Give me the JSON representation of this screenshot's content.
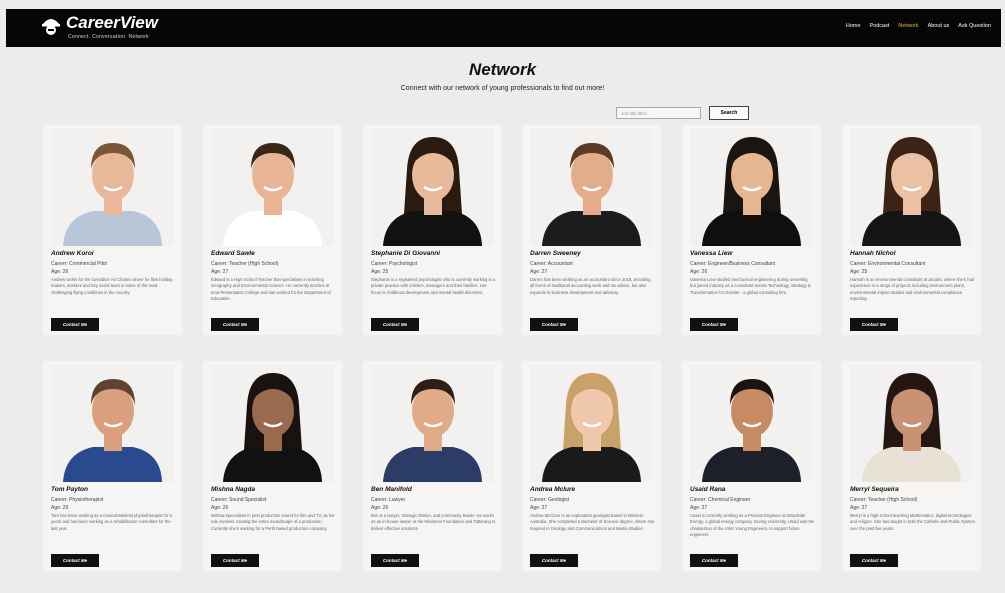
{
  "brand": {
    "name": "CareerView",
    "tagline": "Connect. Conversation. Network"
  },
  "nav": [
    {
      "label": "Home",
      "active": false
    },
    {
      "label": "Podcast",
      "active": false
    },
    {
      "label": "Network",
      "active": true
    },
    {
      "label": "About us",
      "active": false
    },
    {
      "label": "Ask Question",
      "active": false
    }
  ],
  "page": {
    "title": "Network",
    "subtitle": "Connect with our network of young professionals to find out more!"
  },
  "search": {
    "placeholder": "Job title filter...",
    "button_label": "Search"
  },
  "contact_label": "Contact Me",
  "colors": {
    "accent": "#e3b23c",
    "header_bg": "#060606",
    "page_bg": "#eeeceb"
  },
  "profiles": [
    {
      "name": "Andrew Koroi",
      "career": "Career: Commercial Pilot",
      "age": "Age: 26",
      "bio": "Andrew works for the Geraldton Air Charter where he flies holiday makers, workers and tory aerial tours in some of the most challenging flying conditions in the country."
    },
    {
      "name": "Edward Sawle",
      "career": "Career: Teacher (High School)",
      "age": "Age: 27",
      "bio": "Edward is a High School Teacher that specialises in teaching Geography and Environmental Science. He currently teaches at Iona Presentation College and has worked for the Department of Education."
    },
    {
      "name": "Stephanie Di Giovanni",
      "career": "Career: Psychologist",
      "age": "Age: 25",
      "bio": "Stephanie is a registered psychologist who is currently working in a private practice with children, teenagers and their families. Her focus is childhood development and mental health disorders."
    },
    {
      "name": "Darren Sweeney",
      "career": "Career: Accountant",
      "age": "Age: 27",
      "bio": "Darren has been working as an accountant since 2018, providing all forms of traditional accounting work and tax advice, but also expands to business development and advisory."
    },
    {
      "name": "Vanessa Liew",
      "career": "Career: Engineer/Business Consultant",
      "age": "Age: 26",
      "bio": "Vanessa Liew studied mechanical engineering during university, but joined industry as a consultant across Technology, Strategy & Transformation for Deloitte - a global consulting firm."
    },
    {
      "name": "Hannah Nichol",
      "career": "Career: Environmental Consultant",
      "age": "Age: 25",
      "bio": "Hannah is an environmental consultant at Jacobs, where she's had experience in a range of projects including environment plans, environmental impact studies and environmental compliance reporting."
    },
    {
      "name": "Tom Payton",
      "career": "Career: Physiotherapist",
      "age": "Age: 29",
      "bio": "Tom has been working as a musculoskeletal physiotherapist for 5 years and has been working as a rehabilitation consultant for the last year."
    },
    {
      "name": "Mishna Nagda",
      "career": "Career: Sound Specialist",
      "age": "Age: 26",
      "bio": "Mishna specialises in post production sound for film and TV, as her role involves creating the entire soundscape of a production. Currently she's working for a Perth based production company."
    },
    {
      "name": "Ben Manifold",
      "career": "Career: Lawyer",
      "age": "Age: 26",
      "bio": "Ben is a lawyer, strategic thinker, and community leader. He works as an in-house lawyer at the Minderoo Foundation and Tattarang to deliver effective solutions."
    },
    {
      "name": "Andrea Mclure",
      "career": "Career: Geologist",
      "age": "Age: 27",
      "bio": "Andrea McClure is an exploration geologist based in Western Australia. She completed a Bachelor of Science degree, where she majored in Geology and Communications and Media Studies."
    },
    {
      "name": "Usaid Rana",
      "career": "Career: Chemical Engineer",
      "age": "Age: 27",
      "bio": "Usaid is currently working as a Process Engineer at Woodside Energy, a global energy company. During University, Usaid was the chairperson of the UWA Young Engineers, to support future engineers."
    },
    {
      "name": "Merryl Sequeira",
      "career": "Career: Teacher (High School)",
      "age": "Age: 27",
      "bio": "Merryl is a high school teaching Mathematics, digital technologies and religion. She has taught in both the Catholic and Public System over the past five years."
    }
  ]
}
